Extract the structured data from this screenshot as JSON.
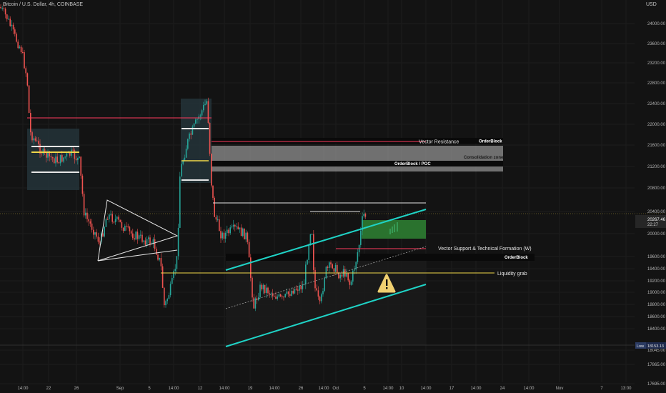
{
  "header": {
    "title": "Bitcoin / U.S. Dollar, 4h, COINBASE",
    "currency": "USD"
  },
  "colors": {
    "background": "#131313",
    "up": "#26a69a",
    "down": "#ef5350",
    "cyan_channel": "#1fd3c6",
    "yellow_line": "#f0d74a",
    "red_line": "#ff3b5c",
    "green_zone": "#2e7d32",
    "white_line": "#e6e6e6",
    "grey_zone": "#bdbdbd"
  },
  "chart_data": {
    "type": "candlestick",
    "y_axis": {
      "ticks": [
        "24000.00",
        "23600.00",
        "23200.00",
        "22800.00",
        "22400.00",
        "22000.00",
        "21600.00",
        "21200.00",
        "20800.00",
        "20400.00",
        "20000.00",
        "19600.00",
        "19400.00",
        "19200.00",
        "19000.00",
        "18800.00",
        "18600.00",
        "18400.00",
        "18045.00",
        "17865.00",
        "17695.00"
      ],
      "range": [
        17595,
        24350
      ]
    },
    "x_axis": {
      "ticks": [
        "14:00",
        "22",
        "26",
        "Sep",
        "5",
        "14:00",
        "12",
        "14:00",
        "19",
        "14:00",
        "26",
        "14:00",
        "Oct",
        "5",
        "14:00",
        "10",
        "14:00",
        "17",
        "14:00",
        "24",
        "14:00",
        "Nov",
        "7",
        "13:00"
      ]
    },
    "current_price": {
      "value": "20267.46",
      "countdown": "22:27"
    },
    "low_marker": {
      "label": "Low",
      "value": "18153.13"
    },
    "annotations": [
      {
        "text": "Vector Resistance"
      },
      {
        "text": "OrderBlock"
      },
      {
        "text": "Consolidation zone"
      },
      {
        "text": "OrderBlock / POC"
      },
      {
        "text": "Vector Support & Technical Formation (W)"
      },
      {
        "text": "OrderBlock"
      },
      {
        "text": "Liquidity grab"
      }
    ]
  }
}
